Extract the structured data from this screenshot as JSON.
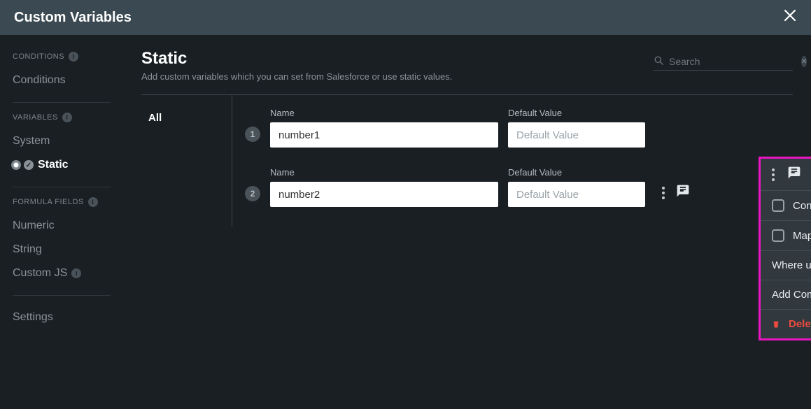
{
  "titlebar": {
    "title": "Custom Variables"
  },
  "sidebar": {
    "groups": [
      {
        "label": "CONDITIONS",
        "items": [
          {
            "label": "Conditions"
          }
        ]
      },
      {
        "label": "VARIABLES",
        "items": [
          {
            "label": "System"
          },
          {
            "label": "Static",
            "active": true
          }
        ]
      },
      {
        "label": "FORMULA FIELDS",
        "items": [
          {
            "label": "Numeric"
          },
          {
            "label": "String"
          },
          {
            "label": "Custom JS",
            "info": true
          }
        ]
      }
    ],
    "settings": "Settings"
  },
  "main": {
    "title": "Static",
    "subtitle": "Add custom variables which you can set from Salesforce or use static values.",
    "search_placeholder": "Search",
    "tab_all": "All",
    "name_label": "Name",
    "default_label": "Default Value",
    "default_placeholder": "Default Value",
    "rows": [
      {
        "num": "1",
        "name": "number1",
        "default": ""
      },
      {
        "num": "2",
        "name": "number2",
        "default": ""
      }
    ]
  },
  "menu": {
    "constant": "Constant",
    "map_url": "Map to URL",
    "where_used": "Where used",
    "add_comment": "Add Comment",
    "delete": "Delete"
  }
}
